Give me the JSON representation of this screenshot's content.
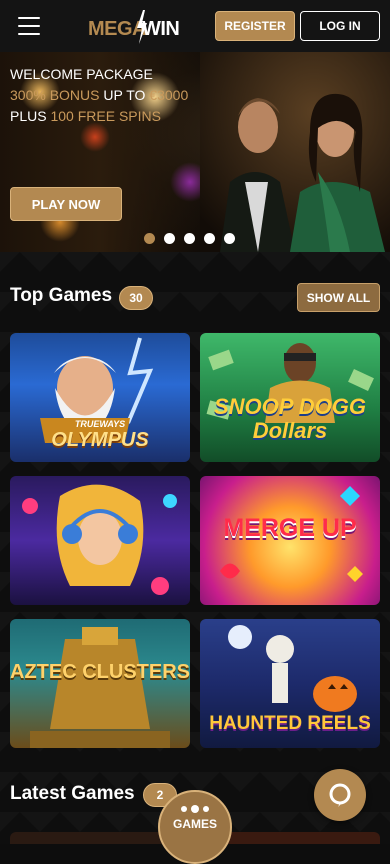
{
  "header": {
    "logo_mega": "MEGA",
    "logo_win": "WIN",
    "register_label": "REGISTER",
    "login_label": "LOG IN"
  },
  "hero": {
    "line1": "WELCOME PACKAGE",
    "line2_gold": "300% BONUS",
    "line2_white": " UP TO ",
    "line2_gold2": "€3000",
    "line3_white": "PLUS ",
    "line3_gold": "100 FREE SPINS",
    "play_label": "PLAY NOW",
    "slide_count": 5,
    "active_slide": 1
  },
  "top_games": {
    "title": "Top Games",
    "count": "30",
    "show_all_label": "SHOW ALL",
    "games": [
      {
        "title_small": "TRUEWAYS",
        "title": "OLYMPUS"
      },
      {
        "title": "SNOOP DOGG Dollars"
      },
      {
        "title": ""
      },
      {
        "title": "MERGE UP"
      },
      {
        "title": "AZTEC CLUSTERS"
      },
      {
        "title": "HAUNTED REELS"
      }
    ]
  },
  "latest_games": {
    "title": "Latest Games",
    "count": "2"
  },
  "nav": {
    "games_label": "GAMES"
  },
  "colors": {
    "accent": "#b38951",
    "background": "#0d0d0d",
    "header": "#141414"
  }
}
